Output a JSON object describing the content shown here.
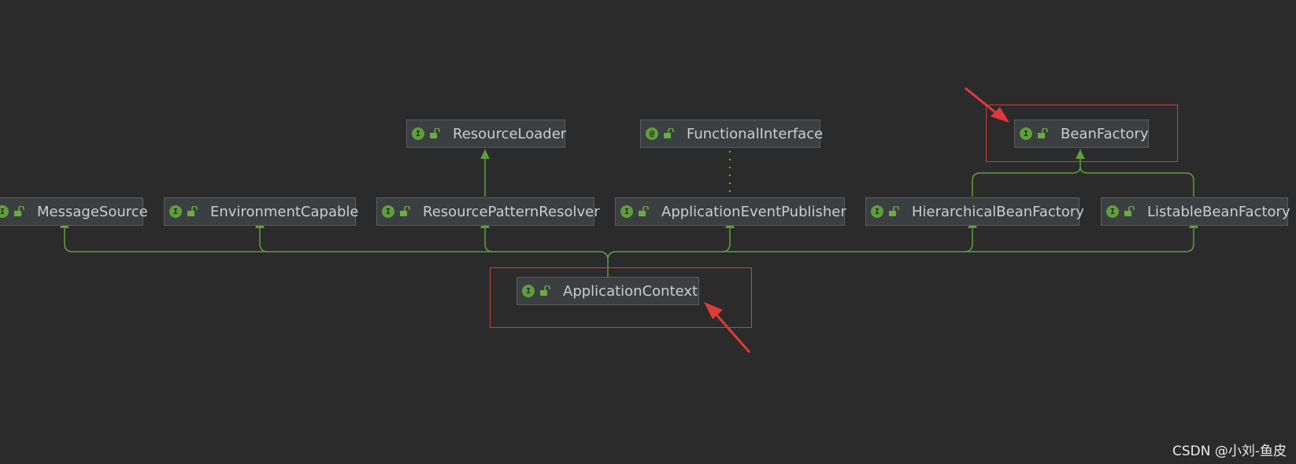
{
  "colors": {
    "background": "#2b2b2b",
    "edge": "#5f9e3d",
    "annotation": "#e0393b",
    "dotted": "#8faa2f"
  },
  "nodes": [
    {
      "id": "resource-loader",
      "label": "ResourceLoader",
      "badge": "I",
      "icon": "interface-icon"
    },
    {
      "id": "functional-interface",
      "label": "FunctionalInterface",
      "badge": "@",
      "icon": "annotation-icon"
    },
    {
      "id": "bean-factory",
      "label": "BeanFactory",
      "badge": "I",
      "icon": "interface-icon"
    },
    {
      "id": "message-source",
      "label": "MessageSource",
      "badge": "I",
      "icon": "interface-icon"
    },
    {
      "id": "environment-capable",
      "label": "EnvironmentCapable",
      "badge": "I",
      "icon": "interface-icon"
    },
    {
      "id": "resource-pattern-resolver",
      "label": "ResourcePatternResolver",
      "badge": "I",
      "icon": "interface-icon"
    },
    {
      "id": "application-event-publisher",
      "label": "ApplicationEventPublisher",
      "badge": "I",
      "icon": "interface-icon"
    },
    {
      "id": "hierarchical-bean-factory",
      "label": "HierarchicalBeanFactory",
      "badge": "I",
      "icon": "interface-icon"
    },
    {
      "id": "listable-bean-factory",
      "label": "ListableBeanFactory",
      "badge": "I",
      "icon": "interface-icon"
    },
    {
      "id": "application-context",
      "label": "ApplicationContext",
      "badge": "I",
      "icon": "interface-icon"
    }
  ],
  "watermark": "CSDN @小刘-鱼皮"
}
